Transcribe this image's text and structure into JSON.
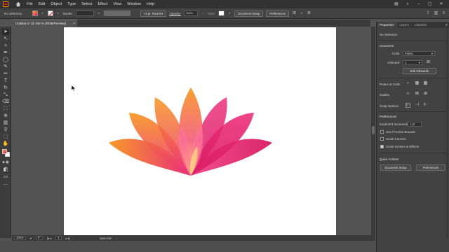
{
  "app": {
    "logo_text": "Ai"
  },
  "menu": {
    "items": [
      "File",
      "Edit",
      "Object",
      "Type",
      "Select",
      "Effect",
      "View",
      "Window",
      "Help"
    ]
  },
  "control_bar": {
    "selection": "No Selection",
    "stroke_label": "Stroke:",
    "brush": "5 pt. Round",
    "opacity_label": "Opacity:",
    "opacity_value": "100%",
    "style_label": "Style:",
    "document_setup": "Document Setup",
    "preferences": "Preferences"
  },
  "document": {
    "tab_title": "Untitled-1* @ 100 % (RGB/Preview)",
    "close": "×"
  },
  "status_bar": {
    "zoom": "100%",
    "rotation": "0°",
    "artboard": "1",
    "tool": "Selection"
  },
  "panel": {
    "tabs": [
      "Properties",
      "Layers",
      "Libraries"
    ],
    "no_selection": "No Selection",
    "document_heading": "Document",
    "units_label": "Units:",
    "units_value": "Points",
    "artboard_label": "Artboard:",
    "artboard_value": "1",
    "edit_artboards": "Edit Artboards",
    "ruler_grids": "Rulers & Grids",
    "guides": "Guides",
    "snap_options": "Snap Options",
    "preferences_heading": "Preferences",
    "keyboard_increment_label": "Keyboard Increment:",
    "keyboard_increment_value": "1 pt",
    "use_preview_bounds": "Use Preview Bounds",
    "scale_corners": "Scale Corners",
    "scale_strokes": "Scale Strokes & Effects",
    "quick_actions": "Quick Actions",
    "document_setup": "Document Setup",
    "preferences": "Preferences"
  },
  "colors": {
    "lotus_orange": "#f7941d",
    "lotus_pink": "#ec2f7b",
    "lotus_magenta": "#d81b60",
    "lotus_yellow": "#ffd54f"
  }
}
